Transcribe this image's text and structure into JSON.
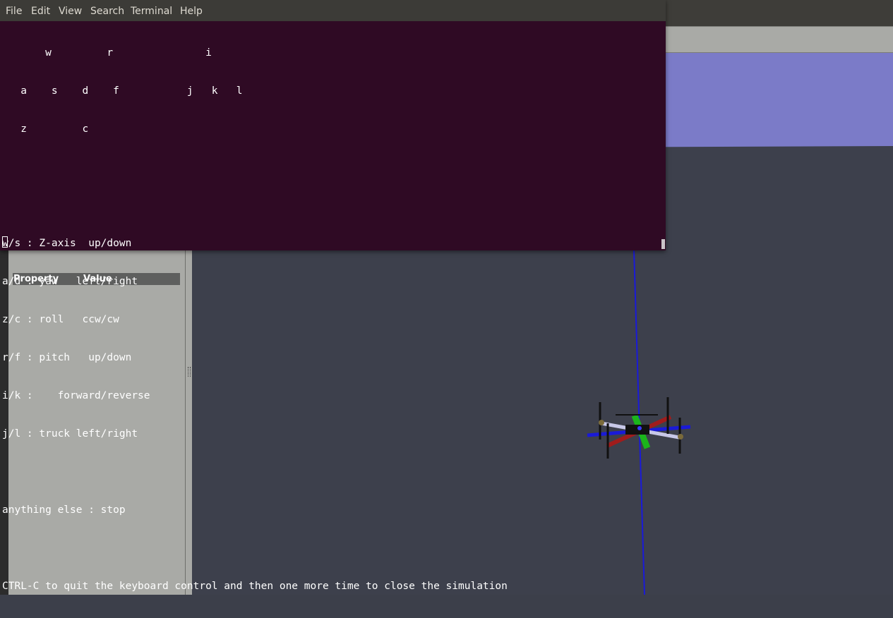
{
  "terminal": {
    "menu": [
      "File",
      "Edit",
      "View",
      "Search",
      "Terminal",
      "Help"
    ],
    "lines": [
      "       w         r               i",
      "   a    s    d    f           j   k   l",
      "   z         c",
      "",
      "",
      "w/s : Z-axis  up/down",
      "a/d : yaw   left/right",
      "z/c : roll   ccw/cw",
      "r/f : pitch   up/down",
      "i/k :    forward/reverse",
      "j/l : truck left/right",
      "",
      "anything else : stop",
      "",
      "CTRL-C to quit the keyboard control and then one more time to close the simulation"
    ]
  },
  "properties": {
    "col_property": "Property",
    "col_value": "Value"
  },
  "scene": {
    "sky_color": "#7b7bc8",
    "ground_color": "#3d404c",
    "axis_x_color": "#1a1ad8",
    "arm_red_color": "#a01c1c",
    "arm_green_color": "#1bb51b"
  }
}
